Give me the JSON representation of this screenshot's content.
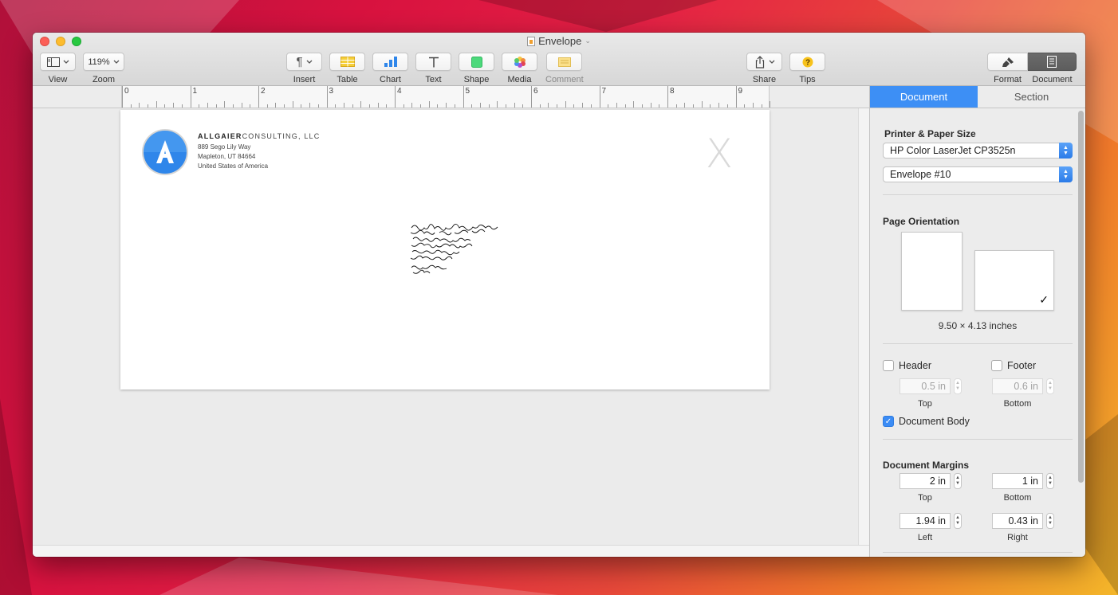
{
  "window": {
    "title": "Envelope"
  },
  "toolbar": {
    "view": {
      "label": "View",
      "icon": "sidebar-icon"
    },
    "zoom": {
      "label": "Zoom",
      "value": "119%"
    },
    "insert": {
      "label": "Insert",
      "icon": "pilcrow-icon"
    },
    "table": {
      "label": "Table",
      "icon": "table-icon"
    },
    "chart": {
      "label": "Chart",
      "icon": "bar-chart-icon"
    },
    "text": {
      "label": "Text",
      "icon": "text-t-icon"
    },
    "shape": {
      "label": "Shape",
      "icon": "square-icon"
    },
    "media": {
      "label": "Media",
      "icon": "photos-icon"
    },
    "comment": {
      "label": "Comment",
      "icon": "comment-icon"
    },
    "share": {
      "label": "Share",
      "icon": "share-icon"
    },
    "tips": {
      "label": "Tips",
      "icon": "question-icon"
    },
    "format": {
      "label": "Format",
      "icon": "paintbrush-icon"
    },
    "document": {
      "label": "Document",
      "icon": "document-icon"
    }
  },
  "ruler": {
    "marks": [
      "0",
      "1",
      "2",
      "3",
      "4",
      "5",
      "6",
      "7",
      "8",
      "9"
    ]
  },
  "envelope": {
    "company_bold": "ALLGAIER",
    "company_rest": "CONSULTING, LLC",
    "address_lines": [
      "889 Sego Lily Way",
      "Mapleton, UT  84664",
      "United States of America"
    ],
    "stamp_mark": "X"
  },
  "inspector": {
    "tabs": [
      "Document",
      "Section"
    ],
    "active_tab": "Document",
    "printer_section": "Printer & Paper Size",
    "printer": "HP Color LaserJet CP3525n",
    "paper": "Envelope #10",
    "orientation_section": "Page Orientation",
    "selected_orientation": "landscape",
    "dimensions": "9.50 × 4.13 inches",
    "header": {
      "label": "Header",
      "checked": false,
      "value": "0.5 in",
      "sublabel": "Top"
    },
    "footer": {
      "label": "Footer",
      "checked": false,
      "value": "0.6 in",
      "sublabel": "Bottom"
    },
    "document_body": {
      "label": "Document Body",
      "checked": true
    },
    "margins_section": "Document Margins",
    "margins": {
      "top": {
        "value": "2 in",
        "label": "Top"
      },
      "bottom": {
        "value": "1 in",
        "label": "Bottom"
      },
      "left": {
        "value": "1.94 in",
        "label": "Left"
      },
      "right": {
        "value": "0.43 in",
        "label": "Right"
      }
    }
  },
  "colors": {
    "accent": "#3d8ff5",
    "logo": "#2f86ea"
  }
}
